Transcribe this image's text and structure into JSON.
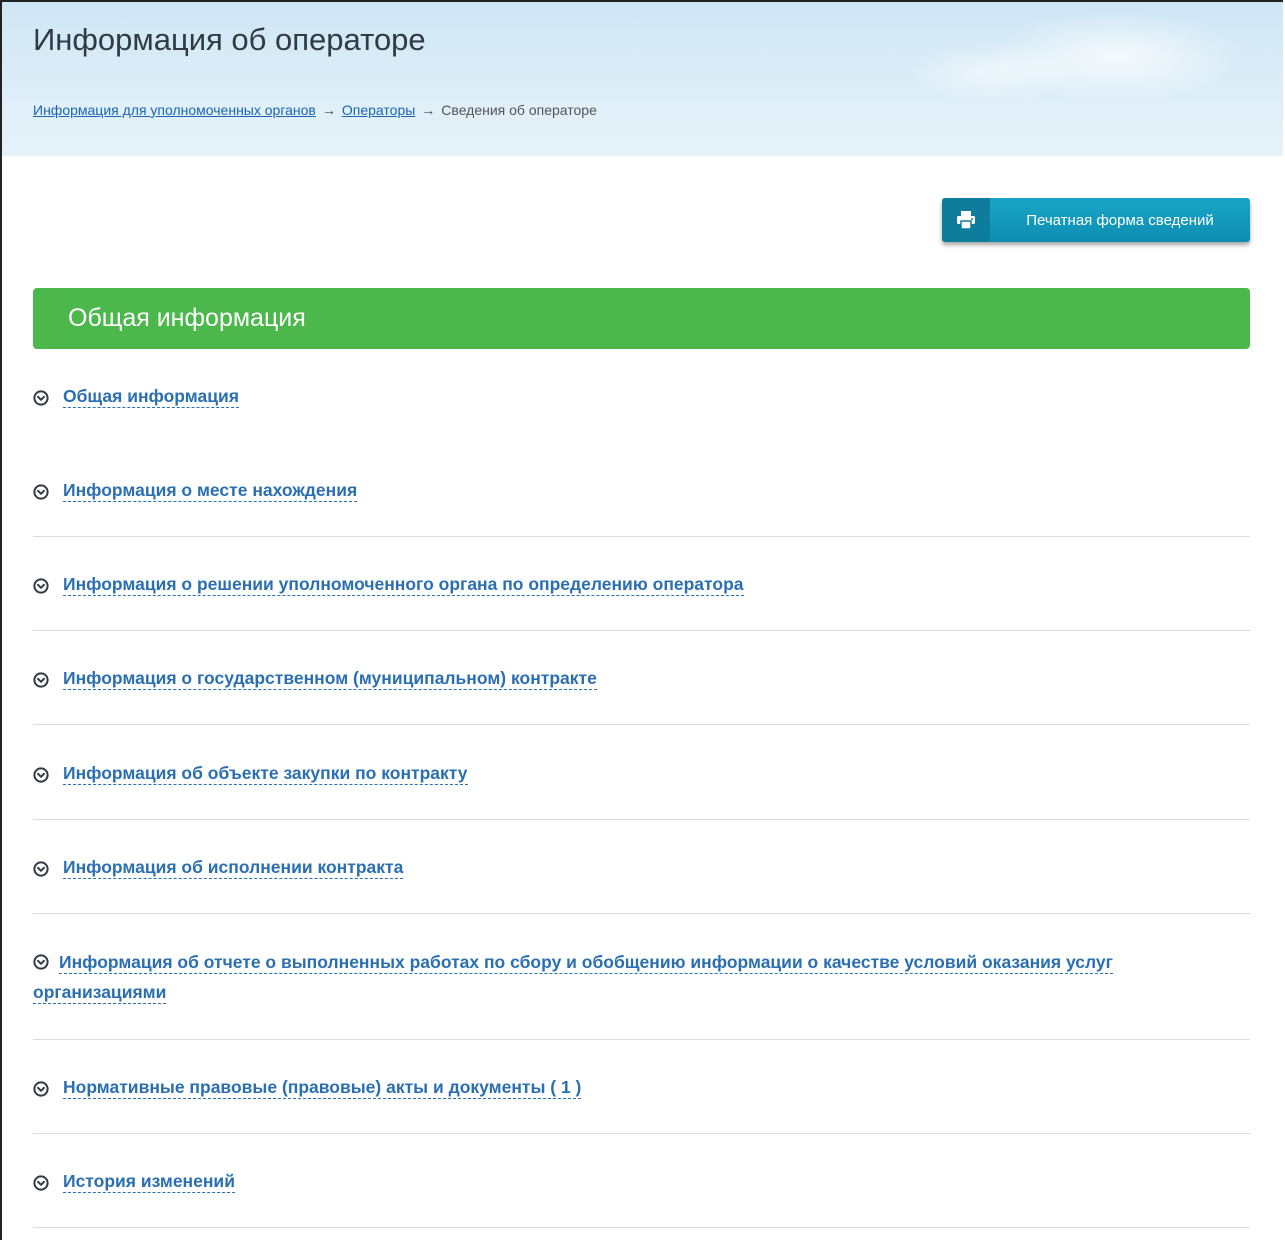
{
  "header": {
    "title": "Информация об операторе",
    "breadcrumb": {
      "link1": "Информация для уполномоченных органов",
      "link2": "Операторы",
      "current": "Сведения об операторе",
      "separator": "→"
    }
  },
  "toolbar": {
    "print_label": "Печатная форма сведений",
    "print_icon": "printer-icon"
  },
  "section": {
    "title": "Общая информация"
  },
  "accordion": {
    "icon": "chevron-circle-down-icon",
    "items": [
      {
        "label": "Общая информация"
      },
      {
        "label": "Информация о месте нахождения"
      },
      {
        "label": "Информация о решении уполномоченного органа по определению оператора"
      },
      {
        "label": "Информация о государственном (муниципальном) контракте"
      },
      {
        "label": "Информация об объекте закупки по контракту"
      },
      {
        "label": "Информация об исполнении контракта"
      },
      {
        "label": "Информация об отчете о выполненных работах по сбору и обобщению информации о качестве условий оказания услуг организациями"
      },
      {
        "label": "Нормативные правовые (правовые) акты и документы ( 1 )"
      },
      {
        "label": "История изменений"
      }
    ]
  },
  "colors": {
    "accent_green": "#4cb84c",
    "link_blue": "#2b6fb1",
    "button_teal": "#1aa6c8"
  }
}
